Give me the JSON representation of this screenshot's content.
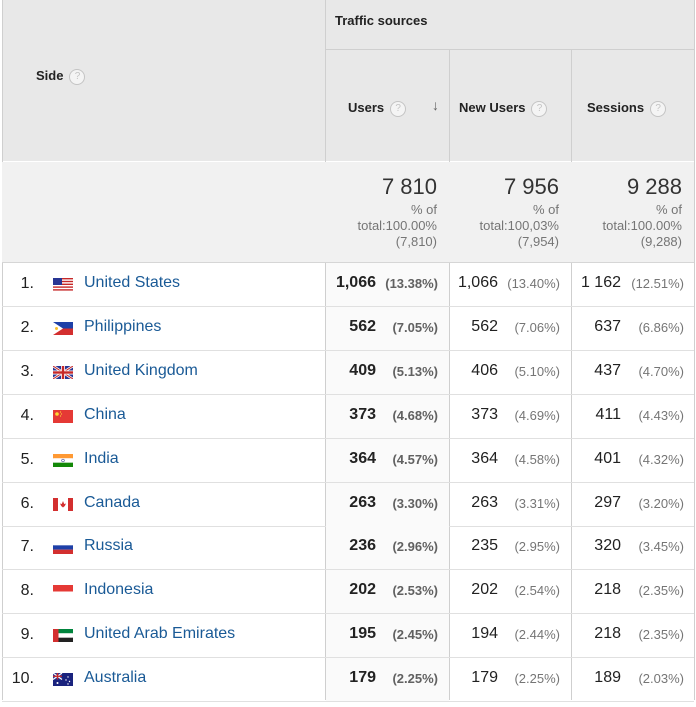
{
  "header": {
    "group_label": "Traffic sources",
    "dimension_label": "Side",
    "help_glyph": "?",
    "sort_glyph": "↓",
    "columns": [
      {
        "label": "Users"
      },
      {
        "label": "New Users"
      },
      {
        "label": "Sessions"
      }
    ]
  },
  "totals": [
    {
      "value": "7 810",
      "line1": "% of",
      "line2": "total:100.00%",
      "line3": "(7,810)"
    },
    {
      "value": "7 956",
      "line1": "% of",
      "line2": "total:100,03%",
      "line3": "(7,954)"
    },
    {
      "value": "9 288",
      "line1": "% of",
      "line2": "total:100.00%",
      "line3": "(9,288)"
    }
  ],
  "rows": [
    {
      "rank": "1.",
      "flag": "us-flag-icon",
      "country": "United States",
      "users": "1,066",
      "users_pct": "(13.38%)",
      "new_users": "1,066",
      "new_users_pct": "(13.40%)",
      "sessions": "1 162",
      "sessions_pct": "(12.51%)"
    },
    {
      "rank": "2.",
      "flag": "ph-flag-icon",
      "country": "Philippines",
      "users": "562",
      "users_pct": "(7.05%)",
      "new_users": "562",
      "new_users_pct": "(7.06%)",
      "sessions": "637",
      "sessions_pct": "(6.86%)"
    },
    {
      "rank": "3.",
      "flag": "uk-flag-icon",
      "country": "United Kingdom",
      "users": "409",
      "users_pct": "(5.13%)",
      "new_users": "406",
      "new_users_pct": "(5.10%)",
      "sessions": "437",
      "sessions_pct": "(4.70%)"
    },
    {
      "rank": "4.",
      "flag": "cn-flag-icon",
      "country": "China",
      "users": "373",
      "users_pct": "(4.68%)",
      "new_users": "373",
      "new_users_pct": "(4.69%)",
      "sessions": "411",
      "sessions_pct": "(4.43%)"
    },
    {
      "rank": "5.",
      "flag": "in-flag-icon",
      "country": "India",
      "users": "364",
      "users_pct": "(4.57%)",
      "new_users": "364",
      "new_users_pct": "(4.58%)",
      "sessions": "401",
      "sessions_pct": "(4.32%)"
    },
    {
      "rank": "6.",
      "flag": "ca-flag-icon",
      "country": "Canada",
      "users": "263",
      "users_pct": "(3.30%)",
      "new_users": "263",
      "new_users_pct": "(3.31%)",
      "sessions": "297",
      "sessions_pct": "(3.20%)"
    },
    {
      "rank": "7.",
      "flag": "ru-flag-icon",
      "country": "Russia",
      "users": "236",
      "users_pct": "(2.96%)",
      "new_users": "235",
      "new_users_pct": "(2.95%)",
      "sessions": "320",
      "sessions_pct": "(3.45%)"
    },
    {
      "rank": "8.",
      "flag": "id-flag-icon",
      "country": "Indonesia",
      "users": "202",
      "users_pct": "(2.53%)",
      "new_users": "202",
      "new_users_pct": "(2.54%)",
      "sessions": "218",
      "sessions_pct": "(2.35%)"
    },
    {
      "rank": "9.",
      "flag": "ae-flag-icon",
      "country": "United Arab Emirates",
      "users": "195",
      "users_pct": "(2.45%)",
      "new_users": "194",
      "new_users_pct": "(2.44%)",
      "sessions": "218",
      "sessions_pct": "(2.35%)"
    },
    {
      "rank": "10.",
      "flag": "au-flag-icon",
      "country": "Australia",
      "users": "179",
      "users_pct": "(2.25%)",
      "new_users": "179",
      "new_users_pct": "(2.25%)",
      "sessions": "189",
      "sessions_pct": "(2.03%)"
    }
  ],
  "colors": {
    "link": "#1a5a96",
    "header_bg": "#e8e8e8",
    "totals_bg": "#f1f1f1"
  }
}
